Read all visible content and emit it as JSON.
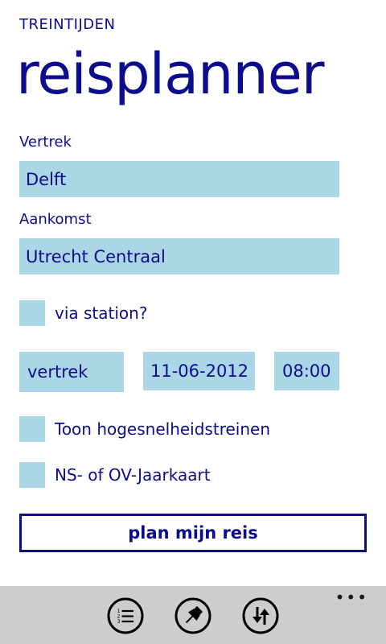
{
  "app": {
    "name": "TREINTIJDEN",
    "page_title": "reisplanner"
  },
  "form": {
    "departure_label": "Vertrek",
    "departure_value": "Delft",
    "arrival_label": "Aankomst",
    "arrival_value": "Utrecht Centraal",
    "via_label": "via station?",
    "time_mode": "vertrek",
    "date": "11-06-2012",
    "time": "08:00",
    "high_speed_label": "Toon hogesnelheidstreinen",
    "annual_pass_label": "NS- of OV-Jaarkaart",
    "plan_button": "plan mijn reis"
  },
  "appbar": {
    "more": "•••",
    "buttons": [
      {
        "icon": "list-icon"
      },
      {
        "icon": "pin-icon"
      },
      {
        "icon": "swap-icon"
      }
    ]
  },
  "colors": {
    "accent": "#0c0c8c",
    "field": "#abd6e6",
    "appbar": "#cdcdcd"
  }
}
